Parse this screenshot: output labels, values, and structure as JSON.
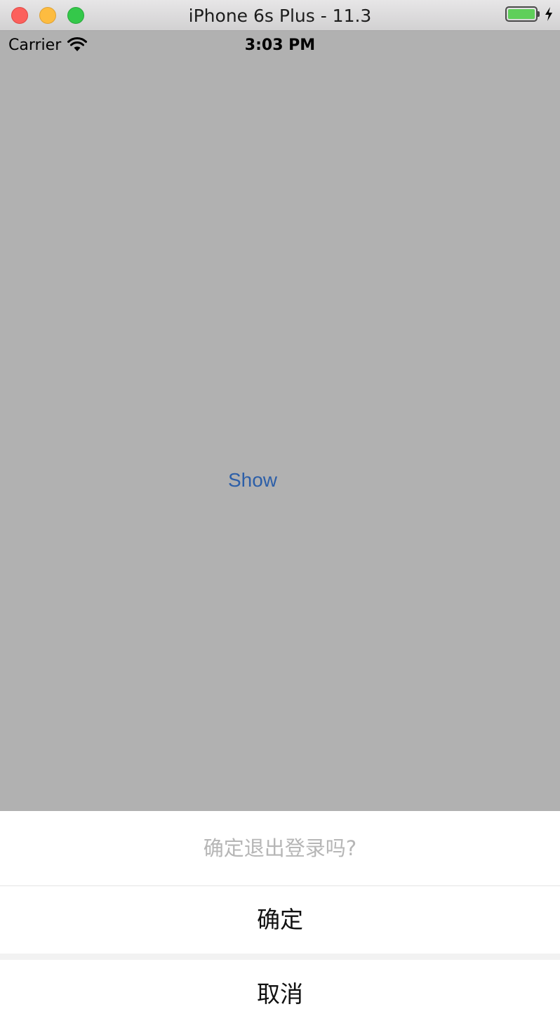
{
  "window": {
    "title": "iPhone 6s Plus - 11.3"
  },
  "status_bar": {
    "carrier": "Carrier",
    "time": "3:03 PM",
    "battery_level": 1.0,
    "charging": true
  },
  "main": {
    "show_button_label": "Show",
    "show_button_color": "#2d5fa8"
  },
  "action_sheet": {
    "title": "确定退出登录吗?",
    "confirm_label": "确定",
    "cancel_label": "取消"
  }
}
